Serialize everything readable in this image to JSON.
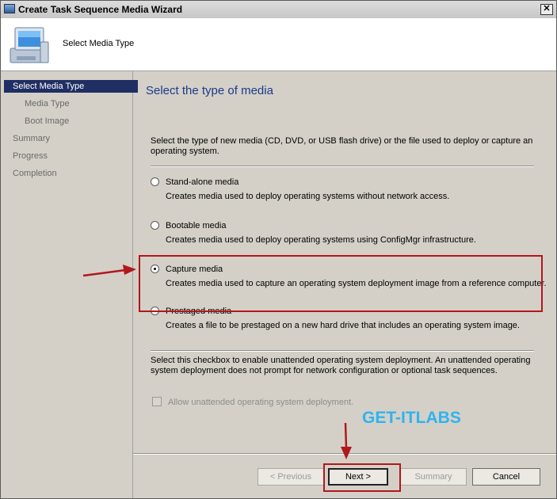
{
  "window": {
    "title": "Create Task Sequence Media Wizard",
    "header_title": "Select Media Type"
  },
  "nav": {
    "items": [
      {
        "label": "Select Media Type",
        "selected": true
      },
      {
        "label": "Media Type",
        "selected": false
      },
      {
        "label": "Boot Image",
        "selected": false
      },
      {
        "label": "Summary",
        "selected": false
      },
      {
        "label": "Progress",
        "selected": false
      },
      {
        "label": "Completion",
        "selected": false
      }
    ]
  },
  "content": {
    "title": "Select the type of media",
    "intro": "Select the type of new media (CD, DVD, or USB flash drive) or the file used to deploy or capture an operating system.",
    "options": [
      {
        "label": "Stand-alone media",
        "description": "Creates media used to deploy operating systems without network access.",
        "checked": false
      },
      {
        "label": "Bootable media",
        "description": "Creates media used to deploy operating systems using ConfigMgr infrastructure.",
        "checked": false
      },
      {
        "label": "Capture media",
        "description": "Creates media used to capture an operating system deployment image from a reference computer.",
        "checked": true
      },
      {
        "label": "Prestaged media",
        "description": "Creates a file to be prestaged on a new hard drive that includes an operating system image.",
        "checked": false
      }
    ],
    "unattended_note": "Select this checkbox to enable unattended operating system deployment. An unattended operating system deployment does not prompt for network configuration or optional task sequences.",
    "unattended_checkbox_label": "Allow unattended operating system deployment.",
    "watermark": "GET-ITLABS"
  },
  "buttons": {
    "previous": "< Previous",
    "next": "Next >",
    "summary": "Summary",
    "cancel": "Cancel"
  },
  "colors": {
    "nav_selected_bg": "#1f2f64",
    "title_color": "#1a3a8a",
    "highlight_red": "#b1171c",
    "watermark": "#2fb3ef"
  }
}
